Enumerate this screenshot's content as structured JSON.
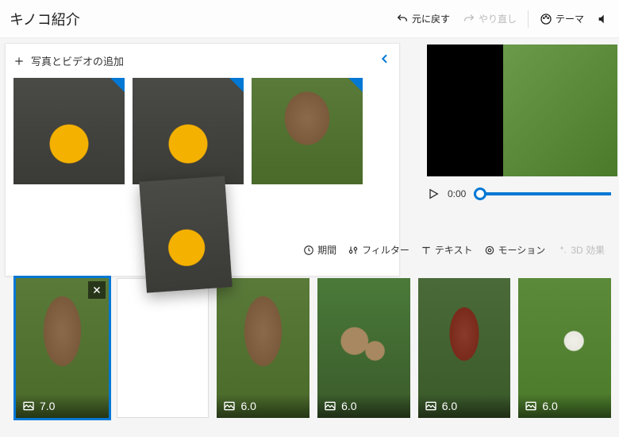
{
  "topbar": {
    "title": "キノコ紹介",
    "undo": "元に戻す",
    "redo": "やり直し",
    "theme": "テーマ"
  },
  "library": {
    "add_label": "写真とビデオの追加"
  },
  "player": {
    "time": "0:00"
  },
  "tools": {
    "duration": "期間",
    "filter": "フィルター",
    "text": "テキスト",
    "motion": "モーション",
    "effects3d": "3D 効果"
  },
  "clips": [
    {
      "duration": "7.0",
      "selected": true,
      "removable": true
    },
    {
      "duration": "",
      "placeholder": true
    },
    {
      "duration": "6.0"
    },
    {
      "duration": "6.0"
    },
    {
      "duration": "6.0"
    },
    {
      "duration": "6.0"
    }
  ]
}
